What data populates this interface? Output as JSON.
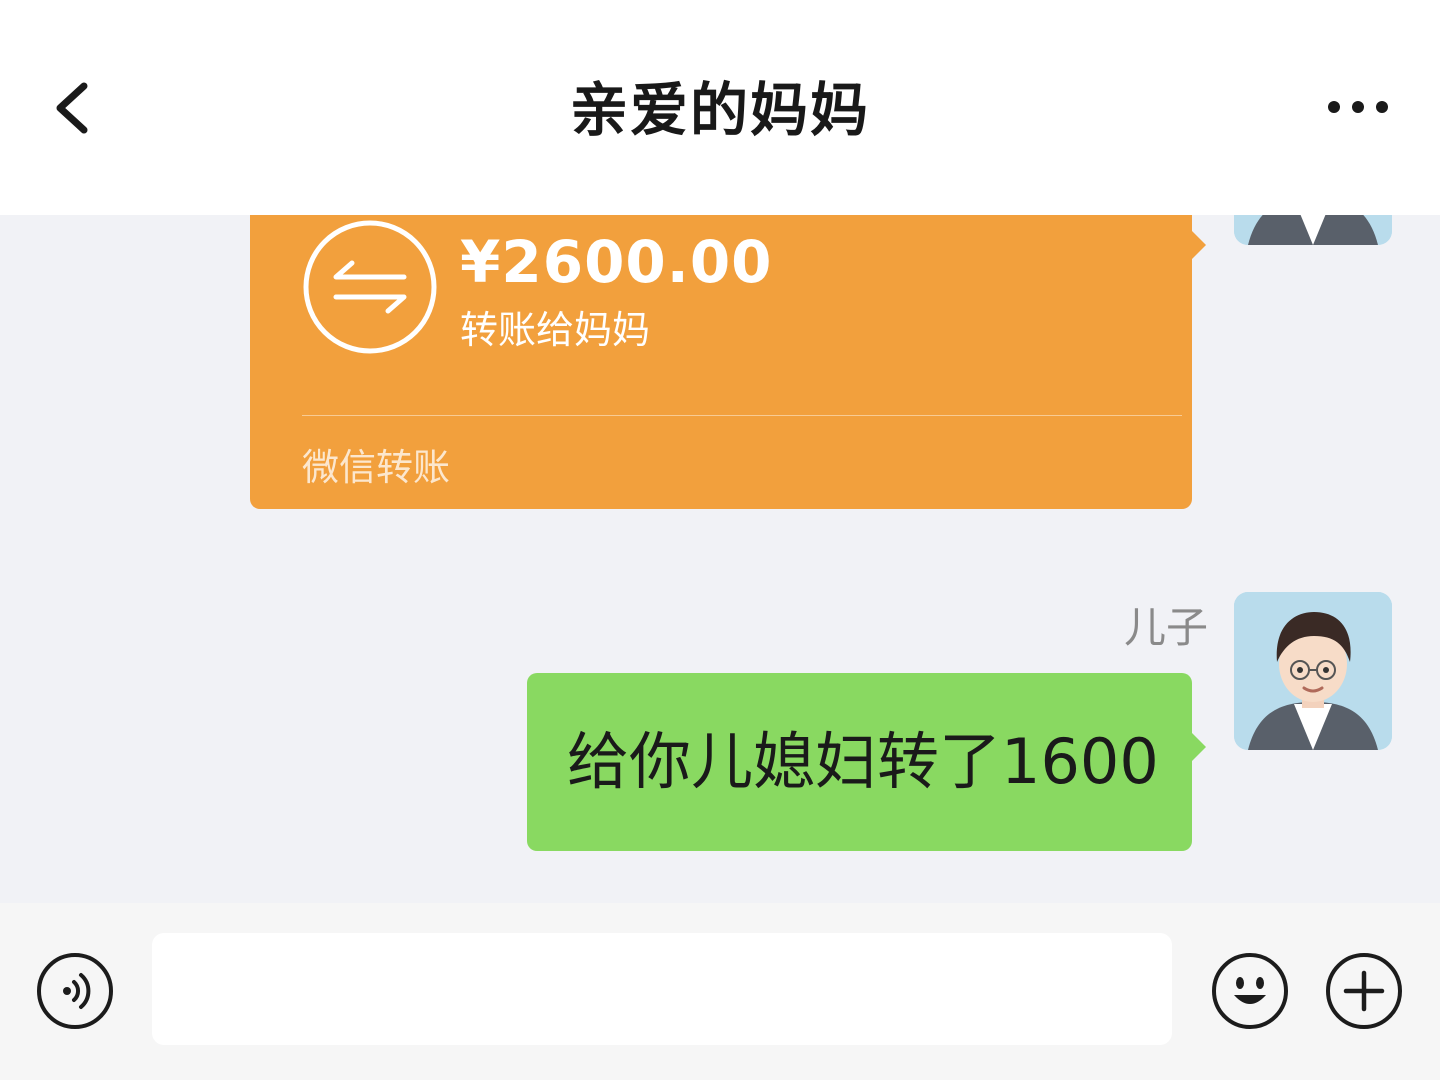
{
  "header": {
    "title": "亲爱的妈妈",
    "back_icon": "chevron-left-icon",
    "more_icon": "more-dots-icon"
  },
  "messages": {
    "transfer": {
      "amount": "¥2600.00",
      "note": "转账给妈妈",
      "footer": "微信转账",
      "color": "#f2a03d",
      "icon": "transfer-arrows-icon"
    },
    "text_message": {
      "sender": "儿子",
      "text": "给你儿媳妇转了1600",
      "color": "#89d961"
    }
  },
  "input_bar": {
    "value": "",
    "voice_icon": "voice-icon",
    "emoji_icon": "emoji-icon",
    "plus_icon": "plus-icon"
  }
}
